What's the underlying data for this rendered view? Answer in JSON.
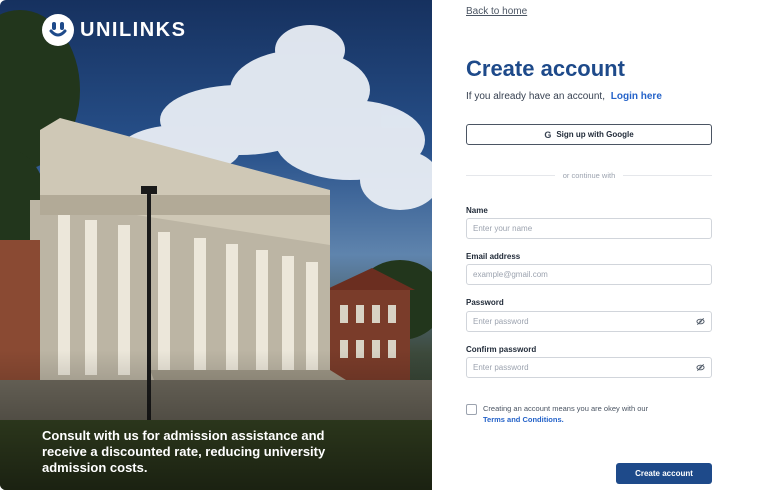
{
  "brand": {
    "name": "UNILINKS",
    "icon": "unilinks-logo-icon"
  },
  "hero": {
    "caption": "Consult with us for admission assistance and receive a discounted rate, reducing university admission costs."
  },
  "nav": {
    "back_label": "Back to home"
  },
  "form": {
    "title": "Create account",
    "subtitle": "If you already have an account,",
    "login_link": "Login here",
    "google_button": "Sign up with Google",
    "divider": "or continue with",
    "fields": [
      {
        "label": "Name",
        "placeholder": "Enter your name"
      },
      {
        "label": "Email address",
        "placeholder": "example@gmail.com"
      },
      {
        "label": "Password",
        "placeholder": "Enter password"
      },
      {
        "label": "Confirm password",
        "placeholder": "Enter password"
      }
    ],
    "terms_text": "Creating an account means you are okey with our",
    "terms_link": "Terms and Conditions.",
    "submit_label": "Create account"
  },
  "colors": {
    "primary": "#1e4a8a",
    "link": "#2563c9",
    "border": "#d1d5db"
  }
}
